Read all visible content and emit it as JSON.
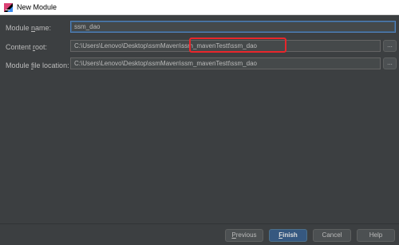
{
  "window": {
    "title": "New Module",
    "icon": "intellij-idea-icon"
  },
  "form": {
    "module_name": {
      "label_pre": "Module ",
      "label_mn": "n",
      "label_post": "ame:",
      "value": "ssm_dao"
    },
    "content_root": {
      "label_pre": "Content ",
      "label_mn": "r",
      "label_post": "oot:",
      "value_part1": "C:\\Users\\Lenovo\\Desktop\\ssmMaven\\",
      "value_part2": "ssm_mavenTestt\\ssm_dao",
      "browse": "..."
    },
    "module_file_location": {
      "label_pre": "Module ",
      "label_mn": "f",
      "label_post": "ile location:",
      "value": "C:\\Users\\Lenovo\\Desktop\\ssmMaven\\ssm_mavenTestt\\ssm_dao",
      "browse": "..."
    }
  },
  "buttons": {
    "previous": {
      "mn": "P",
      "rest": "revious"
    },
    "finish": {
      "mn": "F",
      "rest": "inish"
    },
    "cancel": "Cancel",
    "help": "Help"
  },
  "colors": {
    "dialog_bg": "#3c3f41",
    "field_bg": "#45494a",
    "primary_button": "#365880",
    "highlight_box": "#e8262b"
  }
}
